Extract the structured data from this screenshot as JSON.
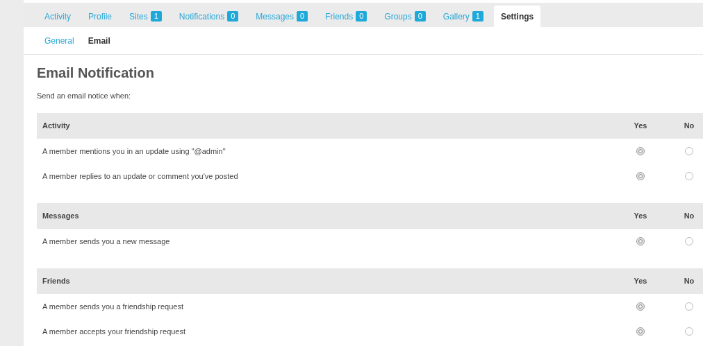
{
  "tabs": [
    {
      "label": "Activity",
      "selected": false
    },
    {
      "label": "Profile",
      "selected": false
    },
    {
      "label": "Sites",
      "badge": "1",
      "selected": false
    },
    {
      "label": "Notifications",
      "badge": "0",
      "selected": false
    },
    {
      "label": "Messages",
      "badge": "0",
      "selected": false
    },
    {
      "label": "Friends",
      "badge": "0",
      "selected": false
    },
    {
      "label": "Groups",
      "badge": "0",
      "selected": false
    },
    {
      "label": "Gallery",
      "badge": "1",
      "selected": false
    },
    {
      "label": "Settings",
      "selected": true
    }
  ],
  "subtabs": [
    {
      "label": "General",
      "selected": false
    },
    {
      "label": "Email",
      "selected": true
    }
  ],
  "title": "Email Notification",
  "intro": "Send an email notice when:",
  "sections": [
    {
      "heading": "Activity",
      "yes_label": "Yes",
      "no_label": "No",
      "rows": [
        {
          "text": "A member mentions you in an update using \"@admin\"",
          "options": [
            {
              "selected": true
            },
            {
              "selected": false
            }
          ]
        },
        {
          "text": "A member replies to an update or comment you've posted",
          "options": [
            {
              "selected": true
            },
            {
              "selected": false
            }
          ]
        }
      ]
    },
    {
      "heading": "Messages",
      "yes_label": "Yes",
      "no_label": "No",
      "rows": [
        {
          "text": "A member sends you a new message",
          "options": [
            {
              "selected": true
            },
            {
              "selected": false
            }
          ]
        }
      ]
    },
    {
      "heading": "Friends",
      "yes_label": "Yes",
      "no_label": "No",
      "rows": [
        {
          "text": "A member sends you a friendship request",
          "options": [
            {
              "selected": true
            },
            {
              "selected": false
            }
          ]
        },
        {
          "text": "A member accepts your friendship request",
          "options": [
            {
              "selected": true
            },
            {
              "selected": false
            }
          ]
        }
      ]
    }
  ]
}
